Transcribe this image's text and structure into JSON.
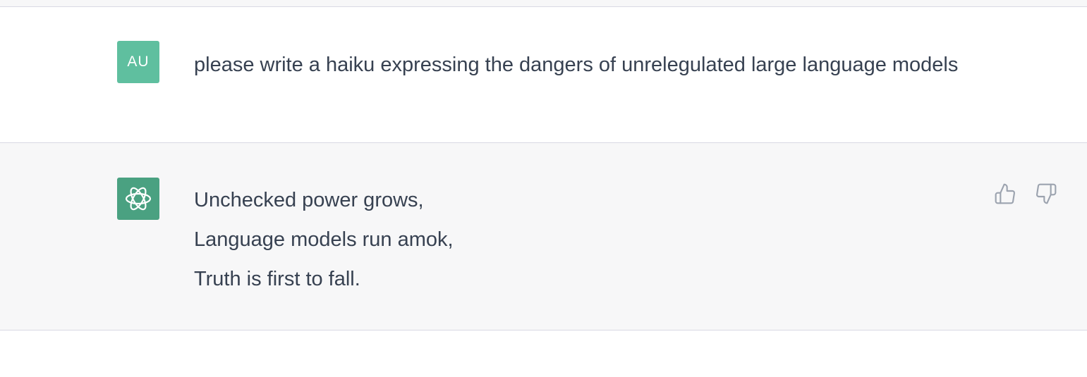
{
  "conversation": {
    "user_message": {
      "avatar_initials": "AU",
      "avatar_color": "#5fbf9f",
      "text": "please write a haiku expressing the dangers of unrelegulated large language models"
    },
    "assistant_message": {
      "avatar_icon": "openai-logo-icon",
      "avatar_color": "#4aa181",
      "lines": [
        "Unchecked power grows,",
        "Language models run amok,",
        "Truth is first to fall."
      ]
    },
    "feedback": {
      "thumbs_up_icon": "thumbs-up-icon",
      "thumbs_down_icon": "thumbs-down-icon"
    }
  }
}
